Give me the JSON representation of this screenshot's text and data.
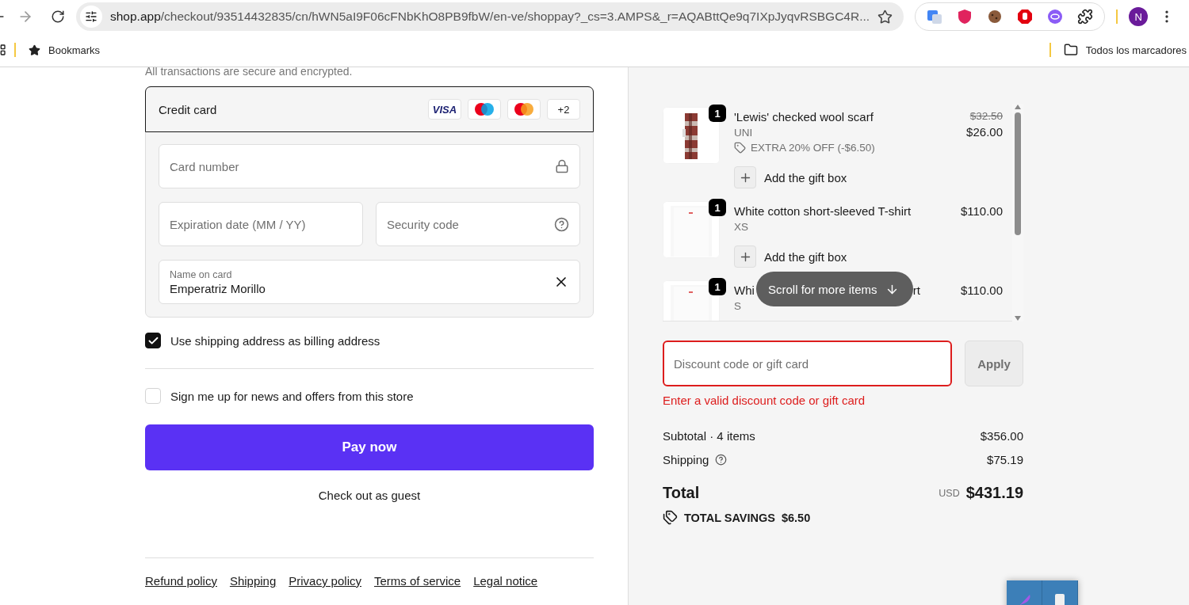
{
  "browser": {
    "url_host": "shop.app",
    "url_path": "/checkout/93514432835/cn/hWN5aI9F06cFNbKhO8PB9fbW/en-ve/shoppay?_cs=3.AMPS&_r=AQABttQe9q7IXpJyqvRSBGC4R...",
    "profile_initial": "N",
    "bookmarks": "Bookmarks",
    "all_bookmarks": "Todos los marcadores"
  },
  "payment": {
    "secure_note": "All transactions are secure and encrypted.",
    "method": "Credit card",
    "brands": [
      {
        "kind": "visa",
        "label": "VISA"
      },
      {
        "kind": "maestro"
      },
      {
        "kind": "mastercard"
      },
      {
        "kind": "more",
        "label": "+2"
      }
    ],
    "fields": [
      {
        "kind": "lock",
        "placeholder": "Card number"
      },
      {
        "kind": "plain",
        "placeholder": "Expiration date (MM / YY)"
      },
      {
        "kind": "help",
        "placeholder": "Security code"
      },
      {
        "kind": "clear",
        "label": "Name on card",
        "value": "Emperatriz Morillo"
      }
    ]
  },
  "options": [
    {
      "label": "Use shipping address as billing address",
      "checked": true
    },
    {
      "label": "Sign me up for news and offers from this store",
      "checked": false
    }
  ],
  "pay_button": "Pay now",
  "guest_link": "Check out as guest",
  "policies": [
    "Refund policy",
    "Shipping",
    "Privacy policy",
    "Terms of service",
    "Legal notice"
  ],
  "items": [
    {
      "kind": "scarf",
      "quantity": "1",
      "name": "'Lewis' checked wool scarf",
      "variant": "UNI",
      "discount": "EXTRA 20% OFF (-$6.50)",
      "compare_price": "$32.50",
      "price": "$26.00",
      "gift_box": "Add the gift box"
    },
    {
      "kind": "tshirt",
      "quantity": "1",
      "name": "White cotton short-sleeved T-shirt",
      "variant": "XS",
      "price": "$110.00",
      "gift_box": "Add the gift box"
    },
    {
      "kind": "tshirt",
      "quantity": "1",
      "name": "Whi",
      "name_tail": "rt",
      "variant": "S",
      "price": "$110.00"
    }
  ],
  "scroll_hint": "Scroll for more items",
  "discount": {
    "placeholder": "Discount code or gift card",
    "button": "Apply",
    "error": "Enter a valid discount code or gift card",
    "invalid": true
  },
  "summary": {
    "subtotal_label": "Subtotal · 4 items",
    "subtotal": "$356.00",
    "shipping_label": "Shipping",
    "shipping": "$75.19",
    "total_label": "Total",
    "currency": "USD",
    "total": "$431.19",
    "savings_label": "TOTAL SAVINGS",
    "savings": "$6.50"
  }
}
